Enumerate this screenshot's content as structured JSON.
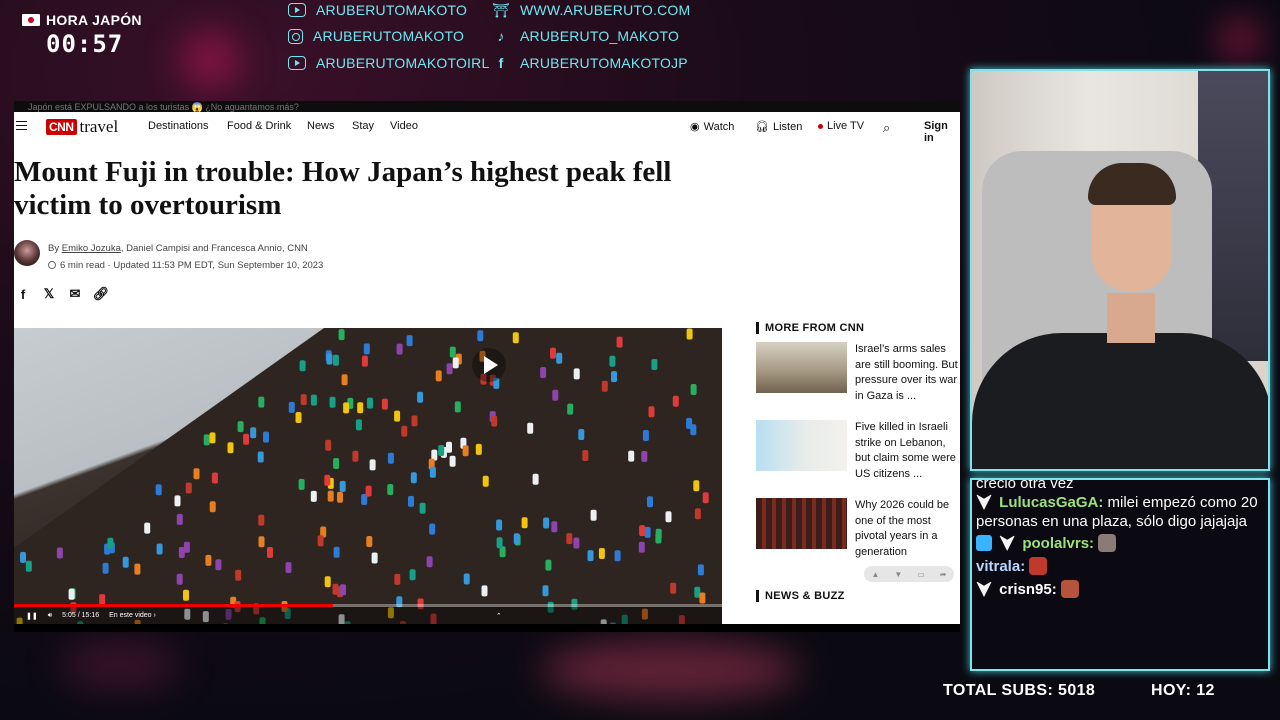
{
  "clock": {
    "label": "HORA JAPÓN",
    "time": "00:57"
  },
  "socials": {
    "youtube_1": "ARUBERUTOMAKOTO",
    "instagram": "ARUBERUTOMAKOTO",
    "youtube_2": "ARUBERUTOMAKOTOIRL",
    "website": "WWW.ARUBERUTO.COM",
    "tiktok": "ARUBERUTO_MAKOTO",
    "facebook": "ARUBERUTOMAKOTOJP",
    "accent_color": "#6fe7f0"
  },
  "browser": {
    "tab_title": "Japón está EXPULSANDO a los turistas 😱 ¿No aguantamos más?",
    "nav": {
      "brand_box": "CNN",
      "brand_word": "travel",
      "links": [
        "Destinations",
        "Food & Drink",
        "News",
        "Stay",
        "Video"
      ],
      "watch": "Watch",
      "listen": "Listen",
      "live_tv": "Live TV",
      "sign_in": "Sign in"
    },
    "article": {
      "headline": "Mount Fuji in trouble: How Japan’s highest peak fell victim to overtourism",
      "by_prefix": "By",
      "author_1": "Emiko Jozuka",
      "authors_rest": ", Daniel Campisi and Francesca Annio, CNN",
      "read_time": "6 min read",
      "updated": "· Updated 11:53 PM EDT, Sun September 10, 2023"
    },
    "video": {
      "time": "5:05 / 15:16",
      "in_video": "En este video ›",
      "progress_fraction": 0.45
    },
    "sidebar": {
      "more_heading": "MORE FROM CNN",
      "stories": [
        "Israel’s arms sales are still booming. But pressure over its war in Gaza is ...",
        "Five killed in Israeli strike on Lebanon, but claim some were US citizens ...",
        "Why 2026 could be one of the most pivotal years in a generation"
      ],
      "news_heading": "NEWS & BUZZ"
    }
  },
  "chat": {
    "partial_line": "creció otra vez",
    "messages": [
      {
        "name": "LulucasGaGA:",
        "name_color": "#9be27a",
        "text": " milei empezó como 20 personas en una plaza, sólo digo jajajaja"
      },
      {
        "name": "poolalvrs:",
        "name_color": "#9be27a",
        "text": ""
      },
      {
        "name": "vitrala:",
        "name_color": "#b7d6ff",
        "text": ""
      },
      {
        "name": "crisn95:",
        "name_color": "#ffffff",
        "text": ""
      }
    ]
  },
  "footer": {
    "total_subs": "TOTAL SUBS: 5018",
    "today": "HOY: 12"
  }
}
